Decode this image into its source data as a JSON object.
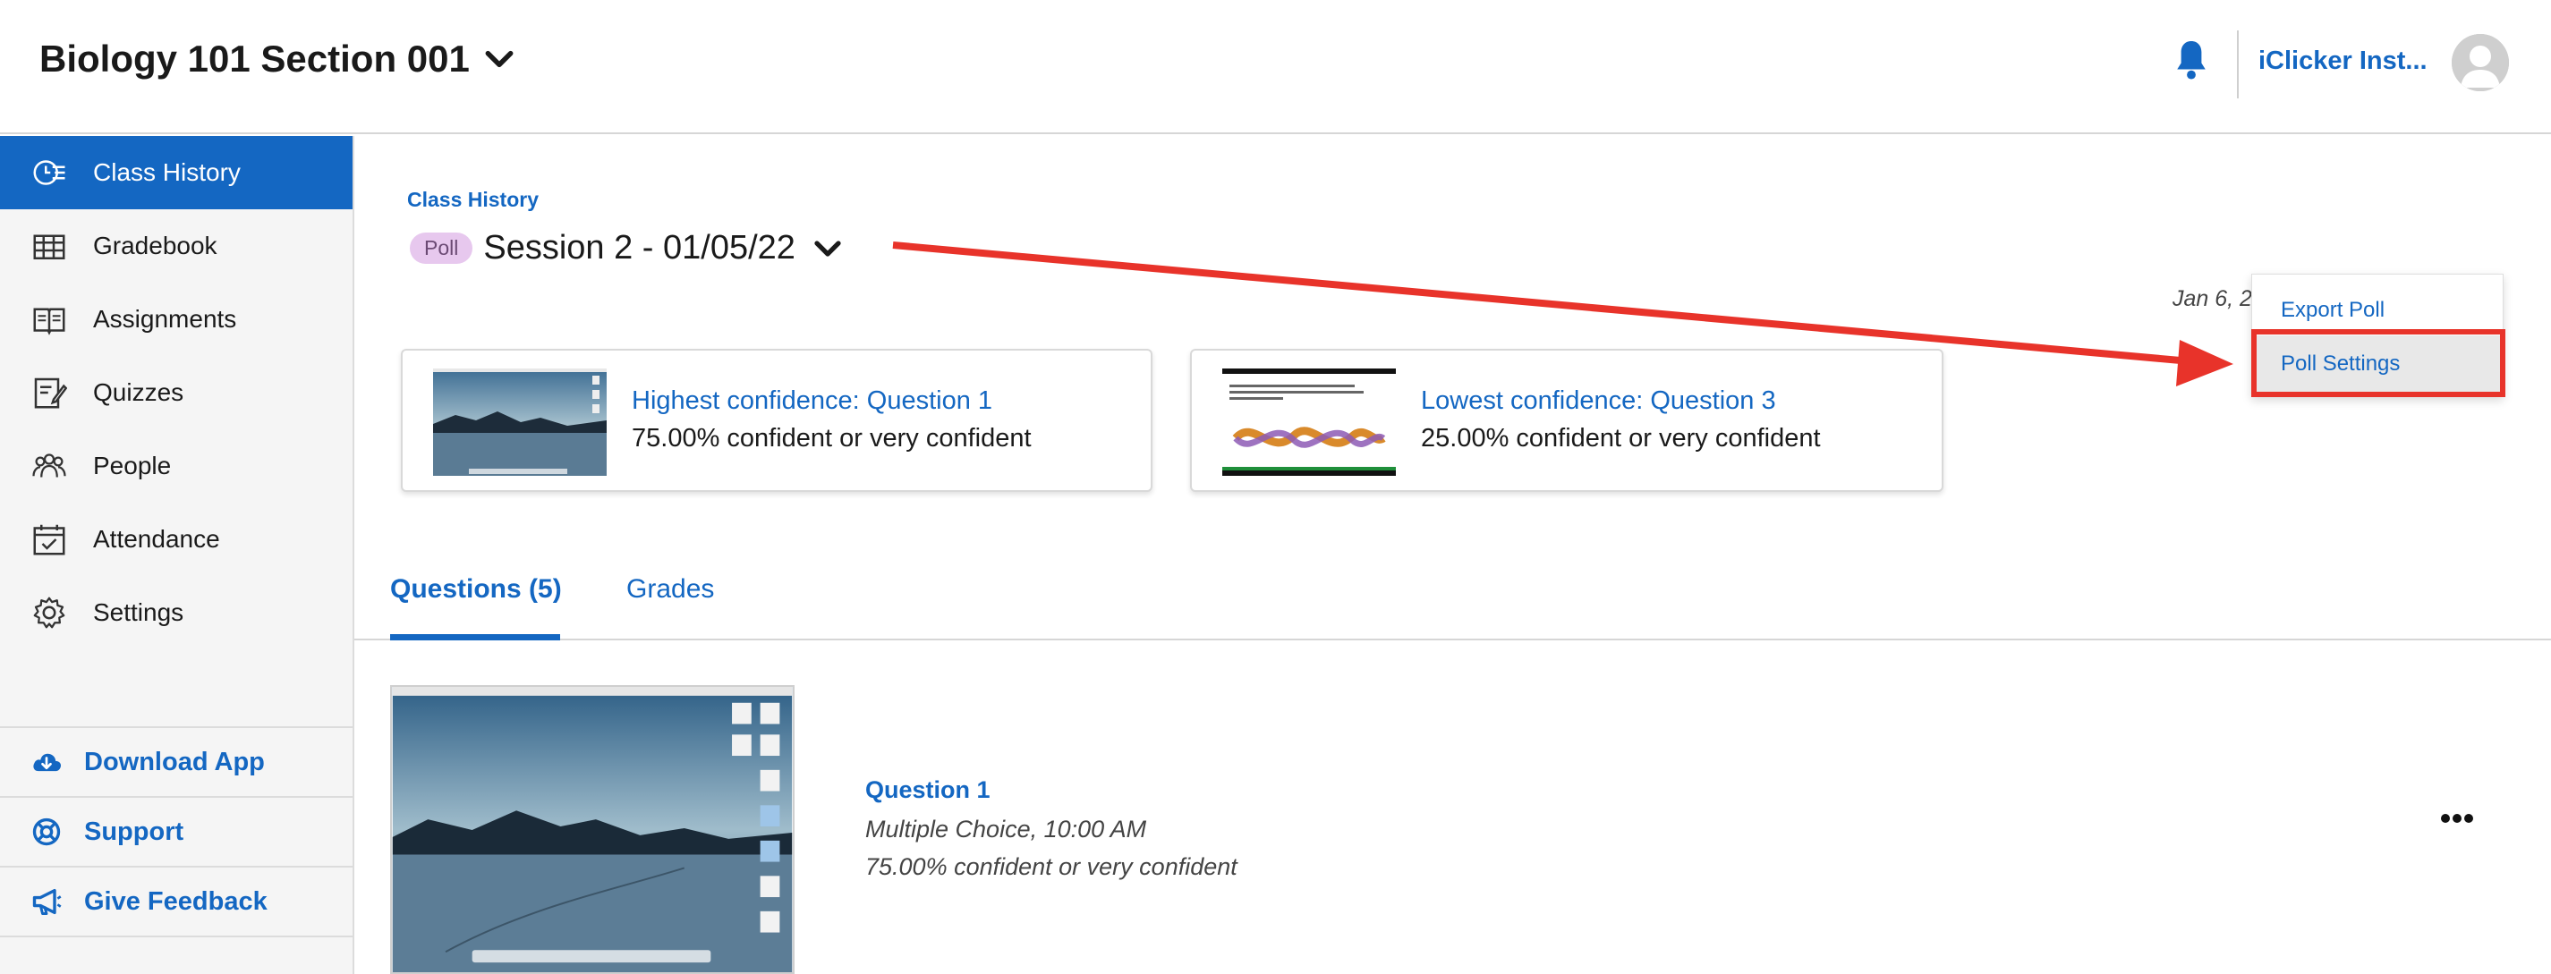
{
  "header": {
    "course_title": "Biology 101 Section 001",
    "user_name": "iClicker Inst..."
  },
  "sidebar": {
    "items": [
      {
        "label": "Class History",
        "icon": "class-history-icon",
        "active": true
      },
      {
        "label": "Gradebook",
        "icon": "gradebook-icon"
      },
      {
        "label": "Assignments",
        "icon": "assignments-icon"
      },
      {
        "label": "Quizzes",
        "icon": "quizzes-icon"
      },
      {
        "label": "People",
        "icon": "people-icon"
      },
      {
        "label": "Attendance",
        "icon": "attendance-icon"
      },
      {
        "label": "Settings",
        "icon": "gear-icon"
      }
    ],
    "links": [
      {
        "label": "Download App",
        "icon": "cloud-download-icon"
      },
      {
        "label": "Support",
        "icon": "lifebuoy-icon"
      },
      {
        "label": "Give Feedback",
        "icon": "megaphone-icon"
      }
    ]
  },
  "main": {
    "breadcrumb": "Class History",
    "badge": "Poll",
    "session_title": "Session 2 - 01/05/22",
    "date": "Jan 6, 2",
    "cards": [
      {
        "title": "Highest confidence: Question 1",
        "subtitle": "75.00% confident or very confident"
      },
      {
        "title": "Lowest confidence: Question 3",
        "subtitle": "25.00% confident or very confident"
      }
    ],
    "menu": {
      "items": [
        "Export Poll",
        "Poll Settings"
      ]
    },
    "tabs": [
      "Questions (5)",
      "Grades"
    ],
    "question": {
      "title": "Question 1",
      "meta": "Multiple Choice, 10:00 AM",
      "confidence": "75.00% confident or very confident"
    }
  },
  "colors": {
    "accent": "#1467c2",
    "annotation": "#e8332a",
    "badge_bg": "#e7c8ee"
  }
}
